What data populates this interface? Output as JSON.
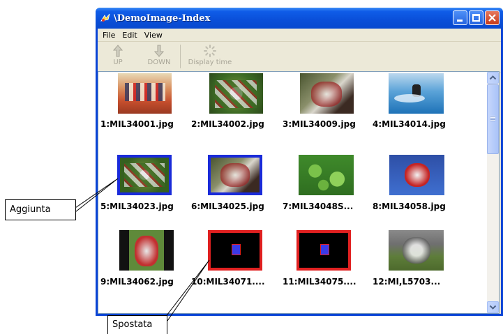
{
  "window": {
    "title": "\\DemoImage-Index"
  },
  "menu": [
    "File",
    "Edit",
    "View"
  ],
  "toolbar": {
    "up": "UP",
    "down": "DOWN",
    "display_time": "Display time"
  },
  "images": [
    "1:MIL34001.jpg",
    "2:MIL34002.jpg",
    "3:MIL34009.jpg",
    "4:MIL34014.jpg",
    "5:MIL34023.jpg",
    "6:MIL34025.jpg",
    "7:MIL34048S...",
    "8:MIL34058.jpg",
    "9:MIL34062.jpg",
    "10:MIL34071....",
    "11:MIL34075....",
    "12:MI,L5703..."
  ],
  "callouts": {
    "added": "Aggiunta",
    "moved": "Spostata"
  },
  "colors": {
    "added_frame": "#1a2bd9",
    "moved_frame": "#e02020",
    "title_bar": "#0a4fd8"
  }
}
